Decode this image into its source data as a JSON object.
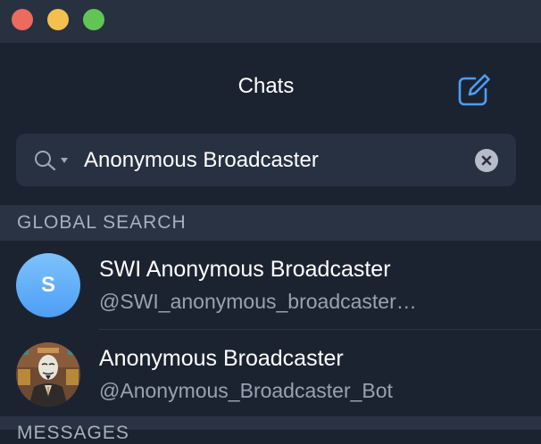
{
  "header": {
    "title": "Chats"
  },
  "search": {
    "query": "Anonymous Broadcaster"
  },
  "global_search": {
    "label": "GLOBAL SEARCH",
    "results": [
      {
        "initial": "S",
        "title": "SWI Anonymous Broadcaster",
        "username": "@SWI_anonymous_broadcaster…"
      },
      {
        "title": "Anonymous Broadcaster",
        "username": "@Anonymous_Broadcaster_Bot"
      }
    ]
  },
  "messages_section": {
    "label": "MESSAGES"
  },
  "colors": {
    "background": "#1c2330",
    "accent": "#4d9ef6",
    "close": "#ec6a5e",
    "minimize": "#f4bf4f",
    "zoom": "#61c554"
  },
  "icons": [
    "compose-icon",
    "search-icon",
    "clear-icon"
  ]
}
